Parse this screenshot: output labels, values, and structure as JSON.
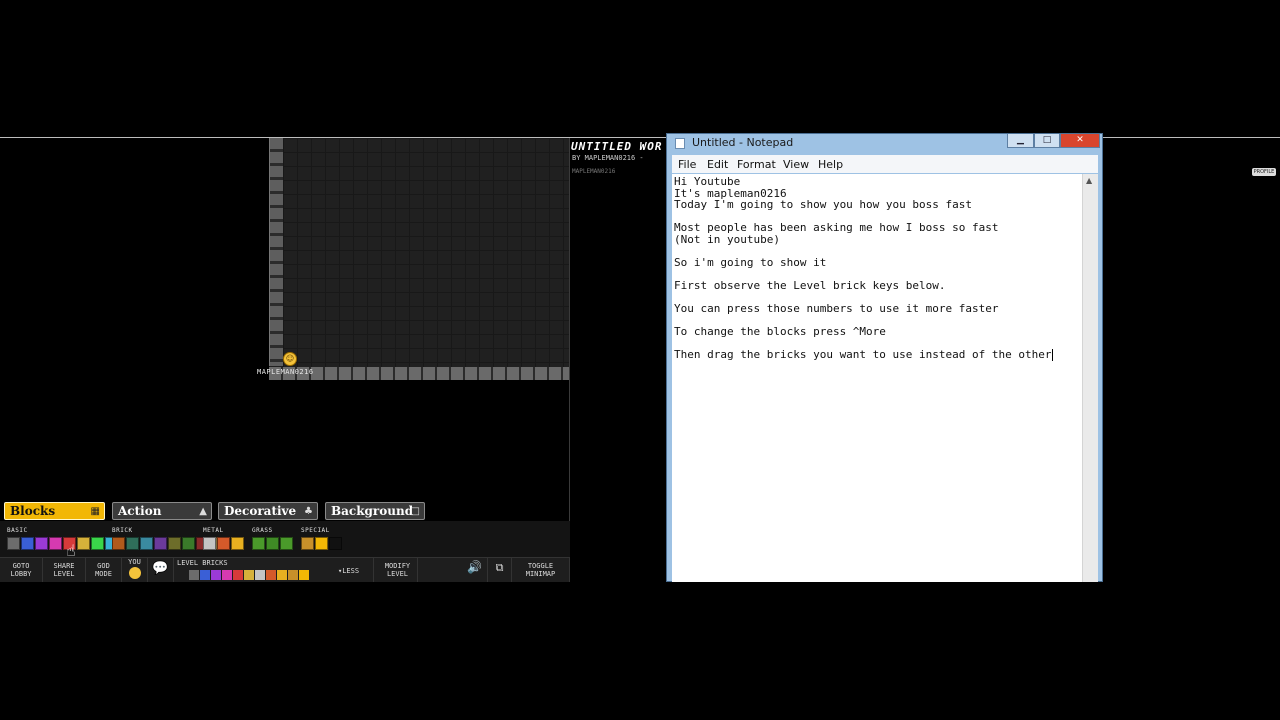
{
  "game": {
    "player_name": "MAPLEMAN0216",
    "world_title": "UNTITLED WOR",
    "world_by": "BY MAPLEMAN0216 -",
    "world_user": "MAPLEMAN0216",
    "profile_label": "PROFILE",
    "tabs": [
      {
        "label": "Blocks",
        "icon": "grid-icon"
      },
      {
        "label": "Action",
        "icon": "triangle-up-icon"
      },
      {
        "label": "Decorative",
        "icon": "tree-icon"
      },
      {
        "label": "Background",
        "icon": "square-icon"
      }
    ],
    "categories": [
      "BASIC",
      "BRICK",
      "METAL",
      "GRASS",
      "SPECIAL"
    ],
    "basic_colors": [
      "#6c6c6c",
      "#3a5fd6",
      "#9b3ad6",
      "#d63ab0",
      "#d63a3a",
      "#d6b13a",
      "#3ad64a",
      "#3ab2d6"
    ],
    "brick_colors": [
      "#b05a1c",
      "#2f6e5a",
      "#3a8aa0",
      "#6b3a9a",
      "#6d6d2a",
      "#3a7a2a",
      "#8a2a2a",
      "#7a6a3a"
    ],
    "metal_colors": [
      "#c4c4c4",
      "#d45a2a",
      "#e8b020"
    ],
    "grass_colors": [
      "#4a9a2a",
      "#3f8a25",
      "#4a9a2a"
    ],
    "special_colors": [
      "#c8902a",
      "#f2b705",
      "#111111"
    ],
    "bottom": {
      "goto_lobby": [
        "GOTO",
        "LOBBY"
      ],
      "share_level": [
        "SHARE",
        "LEVEL"
      ],
      "god_mode": [
        "GOD",
        "MODE"
      ],
      "you_label": "YOU",
      "level_bricks_label": "LEVEL BRICKS",
      "less_label": "LESS",
      "modify_level": [
        "MODIFY",
        "LEVEL"
      ],
      "toggle_minimap": [
        "TOGGLE",
        "MINIMAP"
      ]
    }
  },
  "notepad": {
    "title": "Untitled - Notepad",
    "menu": [
      "File",
      "Edit",
      "Format",
      "View",
      "Help"
    ],
    "lines": [
      "Hi Youtube",
      "It's mapleman0216",
      "Today I'm going to show you how you boss fast",
      "",
      "Most people has been asking me how I boss so fast",
      "(Not in youtube)",
      "",
      "So i'm going to show it",
      "",
      "First observe the Level brick keys below.",
      "",
      "You can press those numbers to use it more faster",
      "",
      "To change the blocks press ^More",
      "",
      "Then drag the bricks you want to use instead of the other"
    ]
  }
}
